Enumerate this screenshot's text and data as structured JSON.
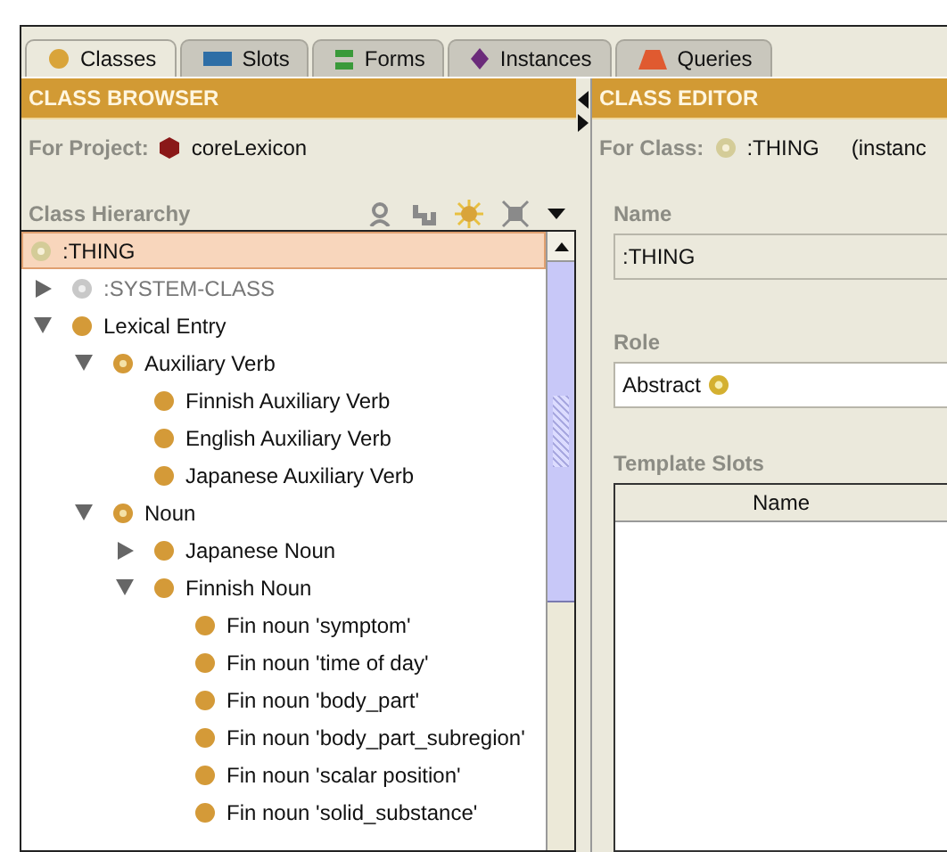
{
  "tabs": [
    {
      "label": "Classes",
      "kind": "class",
      "selected": true
    },
    {
      "label": "Slots",
      "kind": "slot",
      "selected": false
    },
    {
      "label": "Forms",
      "kind": "form",
      "selected": false
    },
    {
      "label": "Instances",
      "kind": "instance",
      "selected": false
    },
    {
      "label": "Queries",
      "kind": "query",
      "selected": false
    }
  ],
  "class_browser": {
    "title": "CLASS BROWSER",
    "project_label": "For Project:",
    "project_name": "coreLexicon",
    "hierarchy_label": "Class Hierarchy",
    "tree": [
      {
        "label": ":THING",
        "kind": "abstract_root",
        "selected": true,
        "children": [
          {
            "label": ":SYSTEM-CLASS",
            "kind": "system",
            "selected": false,
            "expanded": false
          },
          {
            "label": "Lexical Entry",
            "kind": "concrete",
            "selected": false,
            "expanded": true,
            "children": [
              {
                "label": "Auxiliary Verb",
                "kind": "abstract",
                "selected": false,
                "expanded": true,
                "children": [
                  {
                    "label": "Finnish Auxiliary Verb",
                    "kind": "concrete",
                    "selected": false
                  },
                  {
                    "label": "English Auxiliary Verb",
                    "kind": "concrete",
                    "selected": false
                  },
                  {
                    "label": "Japanese Auxiliary Verb",
                    "kind": "concrete",
                    "selected": false
                  }
                ]
              },
              {
                "label": "Noun",
                "kind": "abstract",
                "selected": false,
                "expanded": true,
                "children": [
                  {
                    "label": "Japanese Noun",
                    "kind": "concrete",
                    "selected": false,
                    "expanded": false
                  },
                  {
                    "label": "Finnish Noun",
                    "kind": "concrete",
                    "selected": false,
                    "expanded": true,
                    "children": [
                      {
                        "label": "Fin noun 'symptom'",
                        "kind": "concrete",
                        "selected": false
                      },
                      {
                        "label": "Fin noun 'time of day'",
                        "kind": "concrete",
                        "selected": false
                      },
                      {
                        "label": "Fin noun 'body_part'",
                        "kind": "concrete",
                        "selected": false
                      },
                      {
                        "label": "Fin noun 'body_part_subregion'",
                        "kind": "concrete",
                        "selected": false
                      },
                      {
                        "label": "Fin noun 'scalar position'",
                        "kind": "concrete",
                        "selected": false
                      },
                      {
                        "label": "Fin noun 'solid_substance'",
                        "kind": "concrete",
                        "selected": false
                      }
                    ]
                  }
                ]
              }
            ]
          }
        ]
      }
    ]
  },
  "class_editor": {
    "title": "CLASS EDITOR",
    "class_label": "For Class:",
    "class_name": ":THING",
    "class_note": "(instanc",
    "name_label": "Name",
    "name_value": ":THING",
    "role_label": "Role",
    "role_value": "Abstract",
    "slots_label": "Template Slots",
    "slots_columns": [
      "Name"
    ]
  }
}
